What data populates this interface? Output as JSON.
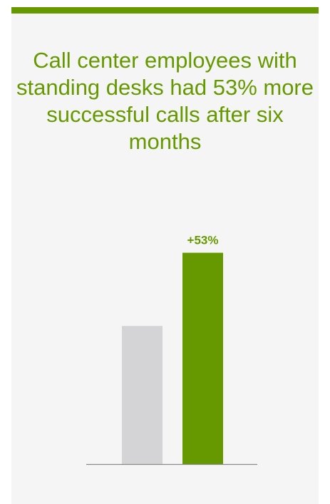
{
  "colors": {
    "accent": "#669900",
    "baseline_bar": "#d4d4d6",
    "axis": "#8a8a8a",
    "background": "#f5f5f5"
  },
  "headline": "Call center employees with standing desks had 53% more successful calls after six months",
  "chart_data": {
    "type": "bar",
    "title": "Call center employees with standing desks had 53% more successful calls after six months",
    "categories": [
      "",
      ""
    ],
    "values": [
      100,
      153
    ],
    "data_labels": [
      "",
      "+53%"
    ],
    "colors": [
      "#d4d4d6",
      "#669900"
    ],
    "xlabel": "",
    "ylabel": "",
    "ylim": [
      0,
      160
    ],
    "grid": false,
    "legend": "none"
  }
}
